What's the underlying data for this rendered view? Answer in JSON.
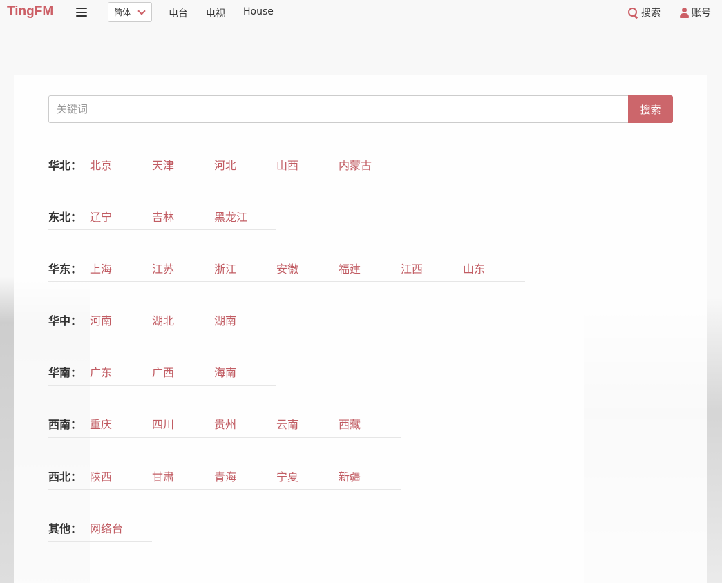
{
  "nav": {
    "brand": "TingFM",
    "lang": "简体",
    "links": [
      "电台",
      "电视",
      "House"
    ],
    "search": "搜索",
    "account": "账号"
  },
  "search": {
    "placeholder": "关键词",
    "button": "搜索"
  },
  "regions": [
    {
      "label": "华北：",
      "provinces": [
        "北京",
        "天津",
        "河北",
        "山西",
        "内蒙古"
      ]
    },
    {
      "label": "东北：",
      "provinces": [
        "辽宁",
        "吉林",
        "黑龙江"
      ]
    },
    {
      "label": "华东：",
      "provinces": [
        "上海",
        "江苏",
        "浙江",
        "安徽",
        "福建",
        "江西",
        "山东"
      ]
    },
    {
      "label": "华中：",
      "provinces": [
        "河南",
        "湖北",
        "湖南"
      ]
    },
    {
      "label": "华南：",
      "provinces": [
        "广东",
        "广西",
        "海南"
      ]
    },
    {
      "label": "西南：",
      "provinces": [
        "重庆",
        "四川",
        "贵州",
        "云南",
        "西藏"
      ]
    },
    {
      "label": "西北：",
      "provinces": [
        "陕西",
        "甘肃",
        "青海",
        "宁夏",
        "新疆"
      ]
    },
    {
      "label": "其他：",
      "provinces": [
        "网络台"
      ]
    }
  ],
  "colors": {
    "accent": "#cc5f66",
    "link": "#c15c63"
  }
}
